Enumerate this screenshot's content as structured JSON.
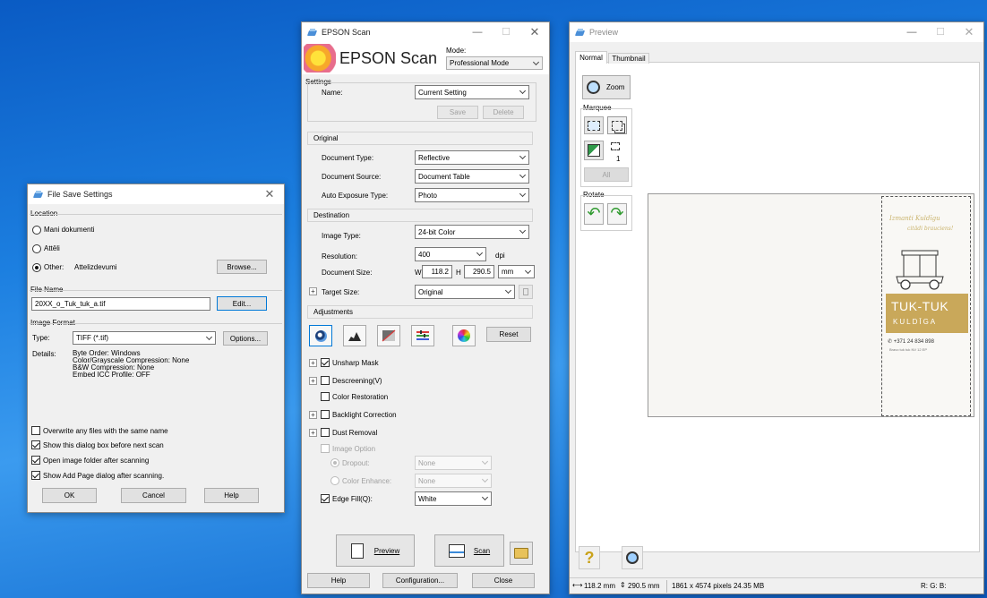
{
  "colors": {
    "desktop": "#1c7fe0",
    "accent": "#0078d7",
    "tuk_gold": "#c9a85a"
  },
  "file_save": {
    "title": "File Save Settings",
    "location_label": "Location",
    "opt_docs": "Mani dokumenti",
    "opt_pics": "Attēli",
    "opt_other": "Other:",
    "other_path": "Attelizdevumi",
    "browse": "Browse...",
    "filename_label": "File Name",
    "filename_value": "20XX_o_Tuk_tuk_a.tif",
    "edit": "Edit...",
    "format_label": "Image Format",
    "type_label": "Type:",
    "type_value": "TIFF (*.tif)",
    "options": "Options...",
    "details_label": "Details:",
    "details": [
      "Byte Order: Windows",
      "Color/Grayscale Compression: None",
      "B&W Compression: None",
      "Embed ICC Profile: OFF"
    ],
    "chk_overwrite": "Overwrite any files with the same name",
    "chk_show": "Show this dialog box before next scan",
    "chk_open": "Open image folder after scanning",
    "chk_addpage": "Show Add Page dialog after scanning.",
    "ok": "OK",
    "cancel": "Cancel",
    "help": "Help"
  },
  "epson": {
    "title": "EPSON Scan",
    "logo_text": "EPSON Scan",
    "mode_label": "Mode:",
    "mode_value": "Professional Mode",
    "settings_label": "Settings",
    "name_label": "Name:",
    "name_value": "Current Setting",
    "save": "Save",
    "delete": "Delete",
    "original_label": "Original",
    "doc_type_label": "Document Type:",
    "doc_type_value": "Reflective",
    "doc_source_label": "Document Source:",
    "doc_source_value": "Document Table",
    "auto_exp_label": "Auto Exposure Type:",
    "auto_exp_value": "Photo",
    "destination_label": "Destination",
    "image_type_label": "Image Type:",
    "image_type_value": "24-bit Color",
    "resolution_label": "Resolution:",
    "resolution_value": "400",
    "dpi": "dpi",
    "doc_size_label": "Document Size:",
    "w_label": "W",
    "w_value": "118.2",
    "h_label": "H",
    "h_value": "290.5",
    "unit_value": "mm",
    "target_label": "Target Size:",
    "target_value": "Original",
    "adjustments_label": "Adjustments",
    "reset": "Reset",
    "unsharp": "Unsharp Mask",
    "descreen": "Descreening(V)",
    "color_rest": "Color Restoration",
    "backlight": "Backlight Correction",
    "dust": "Dust Removal",
    "image_option": "Image Option",
    "dropout": "Dropout:",
    "dropout_value": "None",
    "color_enh": "Color Enhance:",
    "color_enh_value": "None",
    "edge_fill": "Edge Fill(Q):",
    "edge_value": "White",
    "preview": "Preview",
    "scan": "Scan",
    "help": "Help",
    "config": "Configuration...",
    "close": "Close"
  },
  "preview": {
    "title": "Preview",
    "tab_normal": "Normal",
    "tab_thumb": "Thumbnail",
    "zoom": "Zoom",
    "marquee_label": "Marquee",
    "marquee_count": "1",
    "all": "All",
    "rotate_label": "Rotate",
    "status_size": "118.2 mm",
    "status_h": "290.5 mm",
    "status_pixels": "1861 x 4574 pixels 24.35 MB",
    "status_rgb": "R: G: B:",
    "tuk_script1": "Izmanti Kuldīgu",
    "tuk_script2": "citādi brauciens!",
    "tuk_name": "TUK-TUK",
    "tuk_city": "KULDĪGA",
    "tuk_phone": "+371 24 834 898",
    "tuk_small": "Bravo tuk tuk NV 12 EP"
  }
}
